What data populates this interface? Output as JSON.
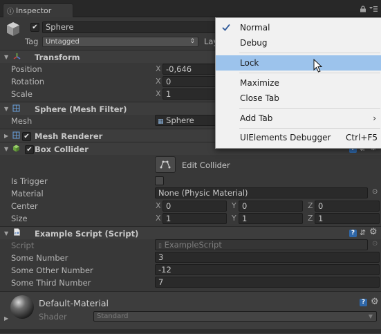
{
  "window": {
    "tab_label": "Inspector"
  },
  "header": {
    "object_name": "Sphere",
    "tag_label": "Tag",
    "tag_value": "Untagged",
    "layer_label_partial": "Lay"
  },
  "transform": {
    "title": "Transform",
    "position_label": "Position",
    "rotation_label": "Rotation",
    "scale_label": "Scale",
    "x_label": "X",
    "position_x": "-0,646",
    "rotation_x": "0",
    "scale_x": "1"
  },
  "mesh_filter": {
    "title": "Sphere (Mesh Filter)",
    "mesh_label": "Mesh",
    "mesh_value": "Sphere"
  },
  "mesh_renderer": {
    "title": "Mesh Renderer"
  },
  "box_collider": {
    "title": "Box Collider",
    "edit_collider_label": "Edit Collider",
    "is_trigger_label": "Is Trigger",
    "material_label": "Material",
    "material_value": "None (Physic Material)",
    "center_label": "Center",
    "size_label": "Size",
    "x": "X",
    "y": "Y",
    "z": "Z",
    "center_x": "0",
    "center_y": "0",
    "center_z": "0",
    "size_x": "1",
    "size_y": "1",
    "size_z": "1"
  },
  "example_script": {
    "title": "Example Script (Script)",
    "script_label": "Script",
    "script_value": "ExampleScript",
    "some_number_label": "Some Number",
    "some_number": "3",
    "some_other_number_label": "Some Other Number",
    "some_other_number": "-12",
    "some_third_number_label": "Some Third Number",
    "some_third_number": "7"
  },
  "material": {
    "name": "Default-Material",
    "shader_label": "Shader",
    "shader_value": "Standard"
  },
  "context_menu": {
    "normal": "Normal",
    "debug": "Debug",
    "lock": "Lock",
    "maximize": "Maximize",
    "close_tab": "Close Tab",
    "add_tab": "Add Tab",
    "uielements_debugger": "UIElements Debugger",
    "uielements_shortcut": "Ctrl+F5",
    "selected_item": "Normal",
    "highlighted_item": "Lock"
  },
  "icons": {
    "check": "check-icon",
    "submenu_arrow": "chevron-right-icon",
    "help": "help-icon",
    "gear": "gear-icon",
    "cursor": "mouse-pointer-icon"
  },
  "colors": {
    "menu_highlight": "#9cc3ec",
    "menu_bg": "#f1f1f1",
    "inspector_bg": "#383838"
  }
}
